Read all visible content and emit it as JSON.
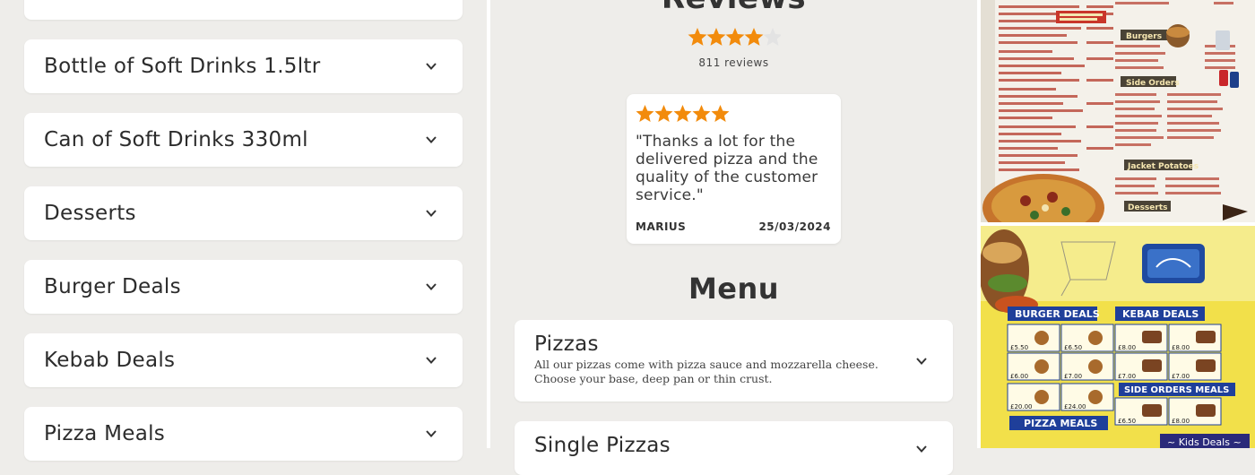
{
  "categories": [
    {
      "label": "Bottle of Soft Drinks 1.5ltr"
    },
    {
      "label": "Can of Soft Drinks 330ml"
    },
    {
      "label": "Desserts"
    },
    {
      "label": "Burger Deals"
    },
    {
      "label": "Kebab Deals"
    },
    {
      "label": "Pizza Meals"
    }
  ],
  "reviews": {
    "heading": "Reviews",
    "rating": 4,
    "rating_max": 5,
    "count_text": "811 reviews",
    "featured": {
      "stars": 5,
      "quote": "\"Thanks a lot for the delivered pizza and the quality of the customer service.\"",
      "author": "MARIUS",
      "date": "25/03/2024"
    }
  },
  "menu": {
    "heading": "Menu",
    "sections": [
      {
        "title": "Pizzas",
        "description": "All our pizzas come with pizza sauce and mozzarella cheese. Choose your base, deep pan or thin crust."
      },
      {
        "title": "Single Pizzas",
        "description": ""
      }
    ]
  },
  "photos": {
    "top": {
      "sections": [
        "Burgers",
        "Side Orders",
        "Jacket Potatoes",
        "Desserts"
      ]
    },
    "bottom": {
      "deals": [
        "BURGER DEALS",
        "KEBAB DEALS",
        "SIDE ORDERS MEALS",
        "PIZZA MEALS",
        "~ Kids Deals ~"
      ],
      "prices": [
        "£5.50",
        "£6.50",
        "£8.00",
        "£8.00",
        "£6.00",
        "£7.00",
        "£7.00",
        "£7.00",
        "£20.00",
        "£24.00",
        "£6.50",
        "£8.00"
      ]
    }
  },
  "colors": {
    "star": "#f28b0c",
    "star_empty": "#e3e3e3",
    "card": "#ffffff",
    "background": "#eeedea"
  }
}
